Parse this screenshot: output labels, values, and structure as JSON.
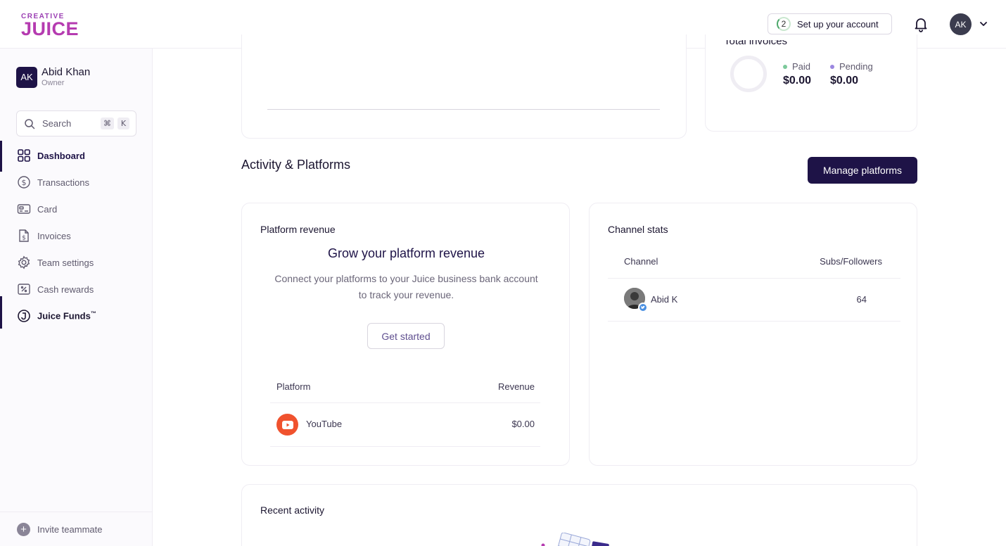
{
  "header": {
    "logo_small": "CREATIVE",
    "logo_big": "JUICE",
    "setup_step": "2",
    "setup_label": "Set up your account",
    "avatar_initials": "AK"
  },
  "sidebar": {
    "user": {
      "initials": "AK",
      "name": "Abid Khan",
      "role": "Owner"
    },
    "search": {
      "label": "Search",
      "shortcut_mod": "⌘",
      "shortcut_key": "K"
    },
    "items": [
      {
        "label": "Dashboard",
        "icon": "grid-icon"
      },
      {
        "label": "Transactions",
        "icon": "dollar-circle-icon"
      },
      {
        "label": "Card",
        "icon": "card-icon"
      },
      {
        "label": "Invoices",
        "icon": "invoice-icon"
      },
      {
        "label": "Team settings",
        "icon": "gear-icon"
      },
      {
        "label": "Cash rewards",
        "icon": "percent-icon"
      },
      {
        "label": "Juice Funds",
        "icon": "juice-funds-icon",
        "trademark": "™"
      }
    ],
    "invite_label": "Invite teammate"
  },
  "invoices": {
    "title": "Total invoices",
    "paid_label": "Paid",
    "paid_value": "$0.00",
    "pending_label": "Pending",
    "pending_value": "$0.00",
    "paid_color": "#7cc99a",
    "pending_color": "#9b87e0"
  },
  "activity": {
    "section_title": "Activity & Platforms",
    "manage_button": "Manage platforms"
  },
  "platform_revenue": {
    "title": "Platform revenue",
    "headline": "Grow your platform revenue",
    "subtext_line1": "Connect your platforms to your Juice business bank account",
    "subtext_line2": "to track your revenue.",
    "cta": "Get started",
    "columns": [
      "Platform",
      "Revenue"
    ],
    "rows": [
      {
        "platform": "YouTube",
        "revenue": "$0.00",
        "icon": "youtube-icon"
      }
    ]
  },
  "channel_stats": {
    "title": "Channel stats",
    "columns": [
      "Channel",
      "Subs/Followers"
    ],
    "rows": [
      {
        "channel": "Abid K",
        "followers": "64",
        "badge_icon": "twitter-icon"
      }
    ]
  },
  "recent_activity": {
    "title": "Recent activity"
  },
  "colors": {
    "brand_dark": "#1e1347",
    "logo": "#b53bb0",
    "youtube": "#f0522e"
  }
}
